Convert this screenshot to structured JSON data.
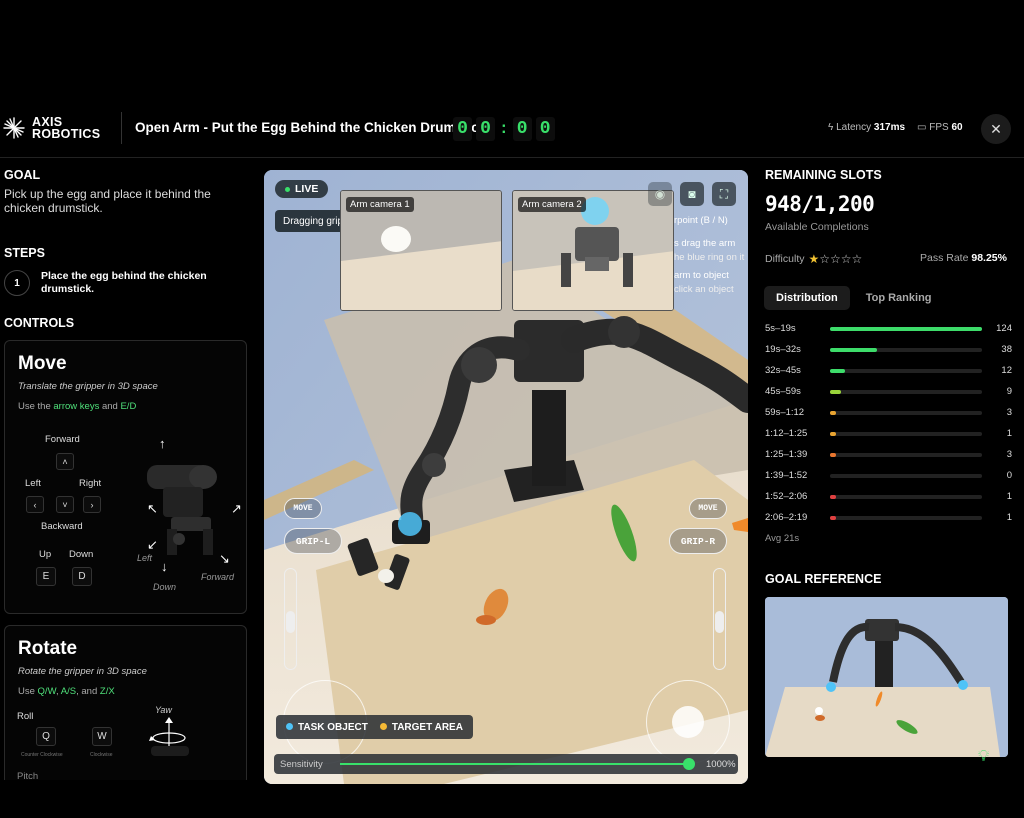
{
  "header": {
    "logo_line1": "AXIS",
    "logo_line2": "ROBOTICS",
    "task_title": "Open Arm - Put the Egg Behind the Chicken Drumstick",
    "timer_digits": [
      "0",
      "0",
      "0",
      "0"
    ],
    "timer_colon": ":",
    "latency_label": "Latency",
    "latency_value": "317ms",
    "fps_label": "FPS",
    "fps_value": "60",
    "close_icon": "close-icon",
    "close_glyph": "✕"
  },
  "goal": {
    "heading": "GOAL",
    "text": "Pick up the egg and place it behind the chicken drumstick."
  },
  "steps": {
    "heading": "STEPS",
    "items": [
      {
        "number": "1",
        "text": "Place the egg behind the chicken drumstick."
      }
    ]
  },
  "controls": {
    "heading": "CONTROLS",
    "move": {
      "title": "Move",
      "subtitle": "Translate the gripper in 3D space",
      "hint_prefix": "Use the",
      "hint_keys1": "arrow keys",
      "hint_and": "and",
      "hint_keys2": "E/D",
      "forward": "Forward",
      "left": "Left",
      "right": "Right",
      "backward": "Backward",
      "up": "Up",
      "down": "Down",
      "key_up": "˄",
      "key_left": "‹",
      "key_down": "˅",
      "key_right": "›",
      "key_e": "E",
      "key_d": "D",
      "diagram_left": "Left",
      "diagram_down": "Down",
      "diagram_forward": "Forward"
    },
    "rotate": {
      "title": "Rotate",
      "subtitle": "Rotate the gripper in 3D space",
      "hint_prefix": "Use",
      "hint_keys1": "Q/W",
      "hint_sep1": ",",
      "hint_keys2": "A/S",
      "hint_sep2": ", and",
      "hint_keys3": "Z/X",
      "roll": "Roll",
      "key_q": "Q",
      "key_w": "W",
      "q_caption": "Counter Clockwise",
      "w_caption": "Clockwise",
      "yaw": "Yaw",
      "pitch": "Pitch"
    }
  },
  "viewport": {
    "live_label": "LIVE",
    "dragging_label": "Dragging gripper",
    "camera1_label": "Arm camera 1",
    "camera2_label": "Arm camera 2",
    "hint_line1": "rpoint (B / N)",
    "hint_line2": "s drag the arm",
    "hint_line3": "he blue ring on it",
    "hint_line4": "arm to object",
    "hint_line5": "click an object",
    "move_left": "MOVE",
    "move_right": "MOVE",
    "grip_left": "GRIP-L",
    "grip_right": "GRIP-R",
    "legend_task": "TASK OBJECT",
    "legend_target": "TARGET AREA",
    "sensitivity_label": "Sensitivity",
    "sensitivity_value": "1000%",
    "sensitivity_level": 0.98
  },
  "right": {
    "remaining_heading": "REMAINING SLOTS",
    "slots": "948/1,200",
    "available": "Available Completions",
    "difficulty_label": "Difficulty",
    "difficulty_stars": 1,
    "difficulty_max": 5,
    "pass_label": "Pass Rate",
    "pass_value": "98.25%",
    "tab_distribution": "Distribution",
    "tab_ranking": "Top Ranking",
    "distribution": [
      {
        "range": "5s–19s",
        "count": "124",
        "value": 124,
        "color": "#3ddc6a"
      },
      {
        "range": "19s–32s",
        "count": "38",
        "value": 38,
        "color": "#3ddc6a"
      },
      {
        "range": "32s–45s",
        "count": "12",
        "value": 12,
        "color": "#3ddc6a"
      },
      {
        "range": "45s–59s",
        "count": "9",
        "value": 9,
        "color": "#9ad43a"
      },
      {
        "range": "59s–1:12",
        "count": "3",
        "value": 3,
        "color": "#e9a431"
      },
      {
        "range": "1:12–1:25",
        "count": "1",
        "value": 1,
        "color": "#e9a431"
      },
      {
        "range": "1:25–1:39",
        "count": "3",
        "value": 3,
        "color": "#e9762f"
      },
      {
        "range": "1:39–1:52",
        "count": "0",
        "value": 0,
        "color": "#e9762f"
      },
      {
        "range": "1:52–2:06",
        "count": "1",
        "value": 1,
        "color": "#e04040"
      },
      {
        "range": "2:06–2:19",
        "count": "1",
        "value": 1,
        "color": "#e04040"
      }
    ],
    "avg": "Avg 21s",
    "goal_ref_heading": "GOAL REFERENCE"
  },
  "colors": {
    "accent_green": "#39e06a",
    "task_object": "#4fc3f7",
    "target_area": "#f5b935"
  }
}
